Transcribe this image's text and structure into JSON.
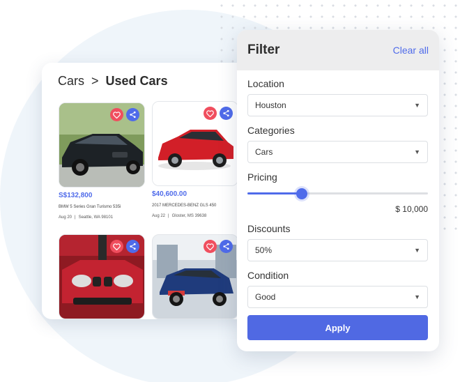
{
  "breadcrumb": {
    "root": "Cars",
    "separator": ">",
    "current": "Used Cars"
  },
  "listings": [
    {
      "price": "S$132,800",
      "name": "BMW 5 Series Gran Turismo 535i",
      "date": "Aug 20",
      "location": "Seattle, WA 98101",
      "photo": "dark-bmw-sedan"
    },
    {
      "price": "$40,600.00",
      "name": "2017 MERCEDES-BENZ GLS 450",
      "date": "Aug 22",
      "location": "Gloster, MS 39638",
      "photo": "red-hatchback"
    },
    {
      "price": "",
      "name": "",
      "date": "",
      "location": "",
      "photo": "red-bmw-front"
    },
    {
      "price": "",
      "name": "",
      "date": "",
      "location": "",
      "photo": "blue-bmw-showroom"
    }
  ],
  "icons": {
    "favorite": "heart-icon",
    "share": "share-icon",
    "dropdown": "chevron-down-icon"
  },
  "filter": {
    "title": "Filter",
    "clear_label": "Clear all",
    "location": {
      "label": "Location",
      "value": "Houston"
    },
    "categories": {
      "label": "Categories",
      "value": "Cars"
    },
    "pricing": {
      "label": "Pricing",
      "value": "$ 10,000",
      "slider_fraction": 0.3
    },
    "discounts": {
      "label": "Discounts",
      "value": "50%"
    },
    "condition": {
      "label": "Condition",
      "value": "Good"
    },
    "apply_label": "Apply"
  },
  "colors": {
    "accent": "#4f6bea",
    "favorite": "#f04e5e",
    "header_bg": "#ededee",
    "backdrop": "#eff5fa"
  }
}
